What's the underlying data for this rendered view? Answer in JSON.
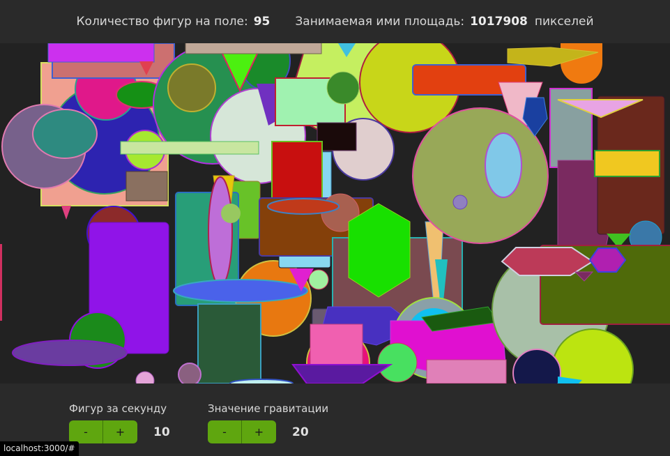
{
  "header": {
    "count_label": "Количество фигур на поле:",
    "count_value": "95",
    "area_label": "Занимаемая ими площадь:",
    "area_value": "1017908",
    "area_unit": "пикселей"
  },
  "controls": {
    "spawn_rate": {
      "label": "Фигур за секунду",
      "minus": "-",
      "plus": "+",
      "value": "10"
    },
    "gravity": {
      "label": "Значение гравитации",
      "minus": "-",
      "plus": "+",
      "value": "20"
    }
  },
  "status_bar": {
    "url": "localhost:3000/#"
  },
  "colors": {
    "accent": "#5fa60f",
    "background": "#212121",
    "panel": "#2a2a2a"
  }
}
